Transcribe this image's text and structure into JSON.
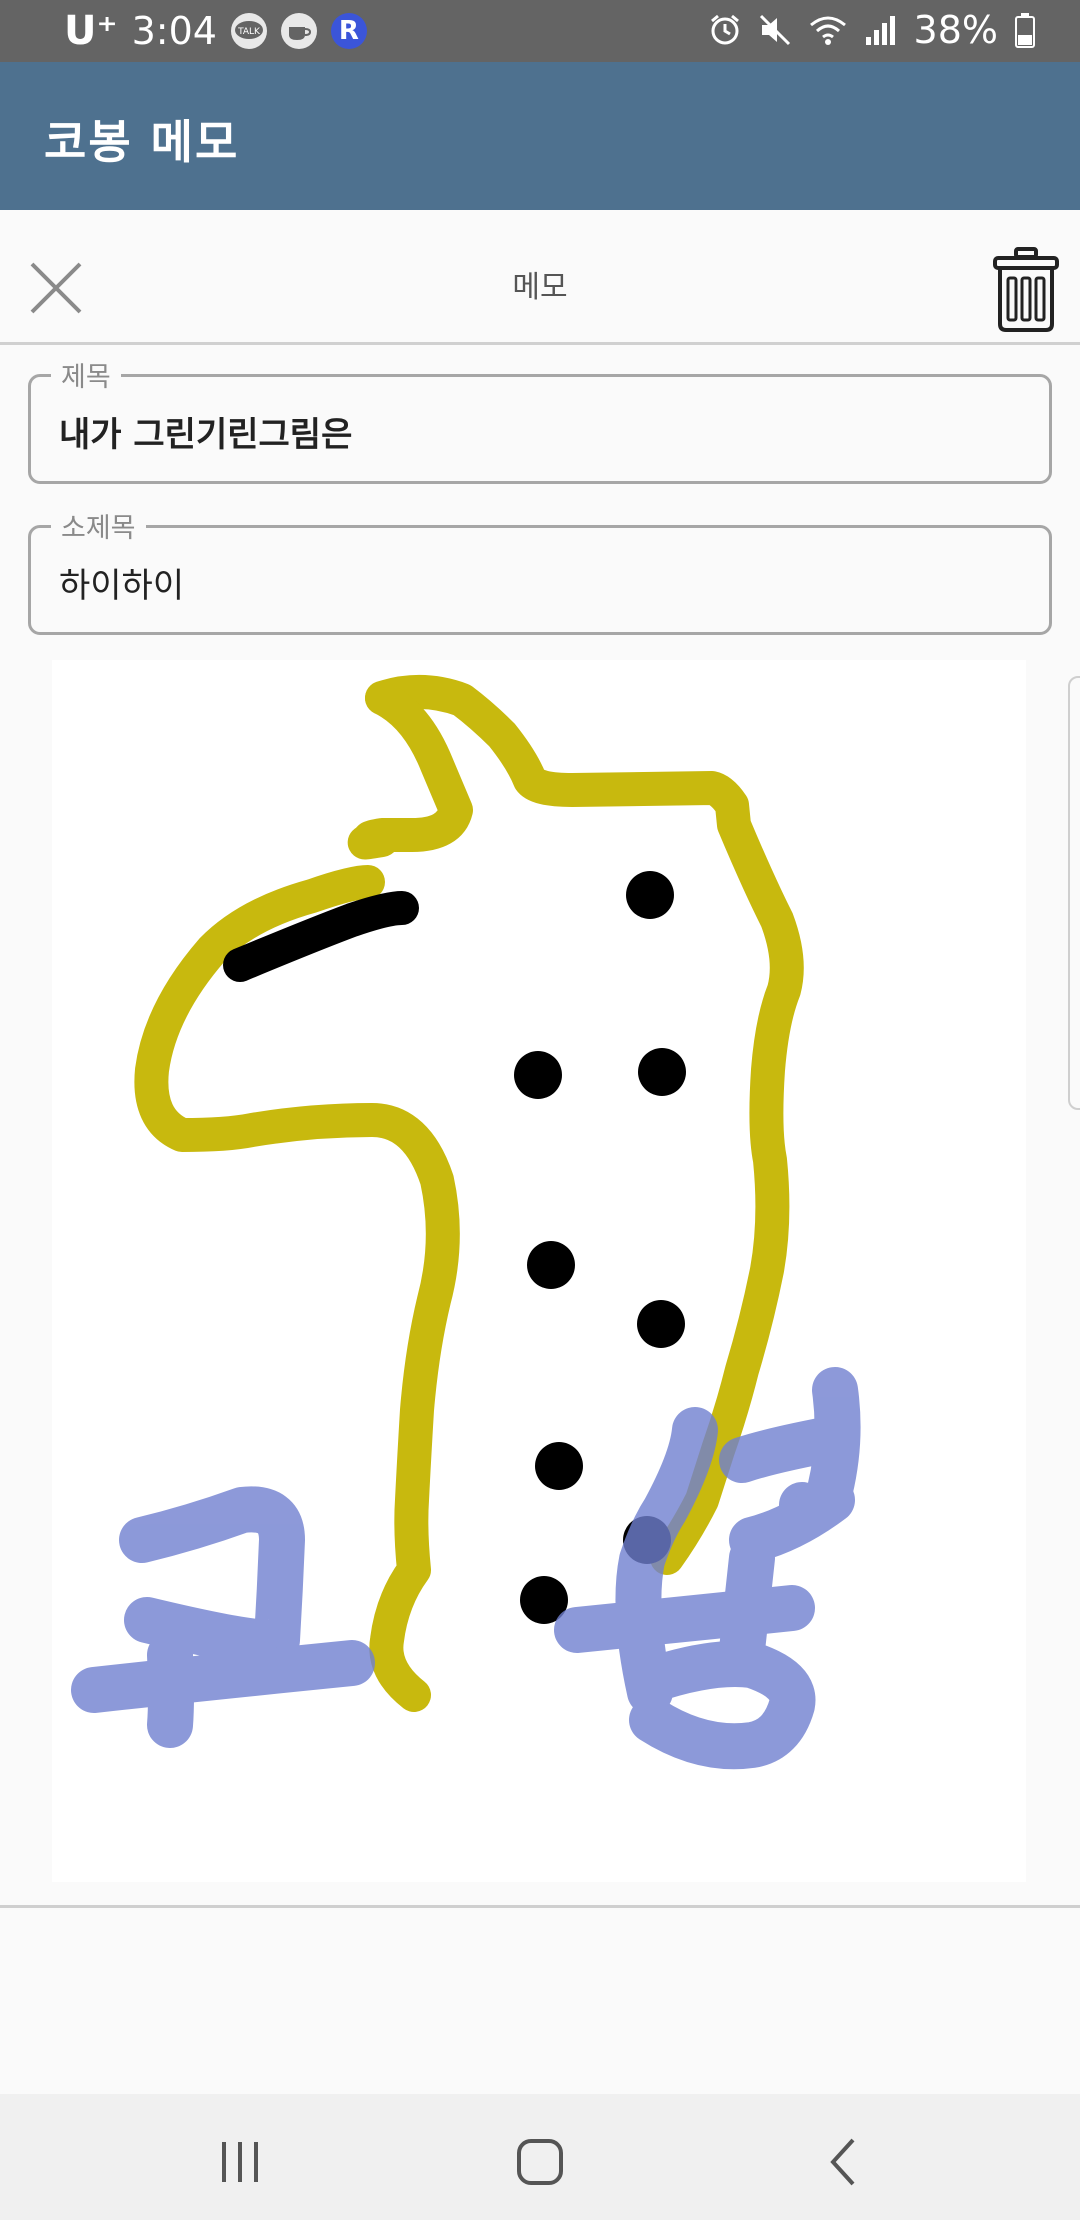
{
  "status_bar": {
    "carrier": "U⁺",
    "time": "3:04",
    "battery": "38%",
    "left_icons": [
      "kakaotalk-icon",
      "coffee-icon",
      "r-app-icon"
    ],
    "right_icons": [
      "alarm-icon",
      "mute-icon",
      "wifi-icon",
      "signal-icon",
      "battery-icon"
    ]
  },
  "app_bar": {
    "title": "코봉 메모"
  },
  "editor_bar": {
    "title": "메모"
  },
  "fields": {
    "title": {
      "label": "제목",
      "value": "내가 그린기린그림은"
    },
    "subtitle": {
      "label": "소제목",
      "value": "하이하이"
    }
  },
  "drawing": {
    "description_colors": {
      "giraffe_outline": "#c8b90e",
      "spots": "#000000",
      "handwriting": "#7f8fd6"
    }
  },
  "navbar": {
    "buttons": [
      "recent-apps",
      "home",
      "back"
    ]
  },
  "colors": {
    "app_bar": "#4e718f",
    "status_bar": "#646464"
  }
}
